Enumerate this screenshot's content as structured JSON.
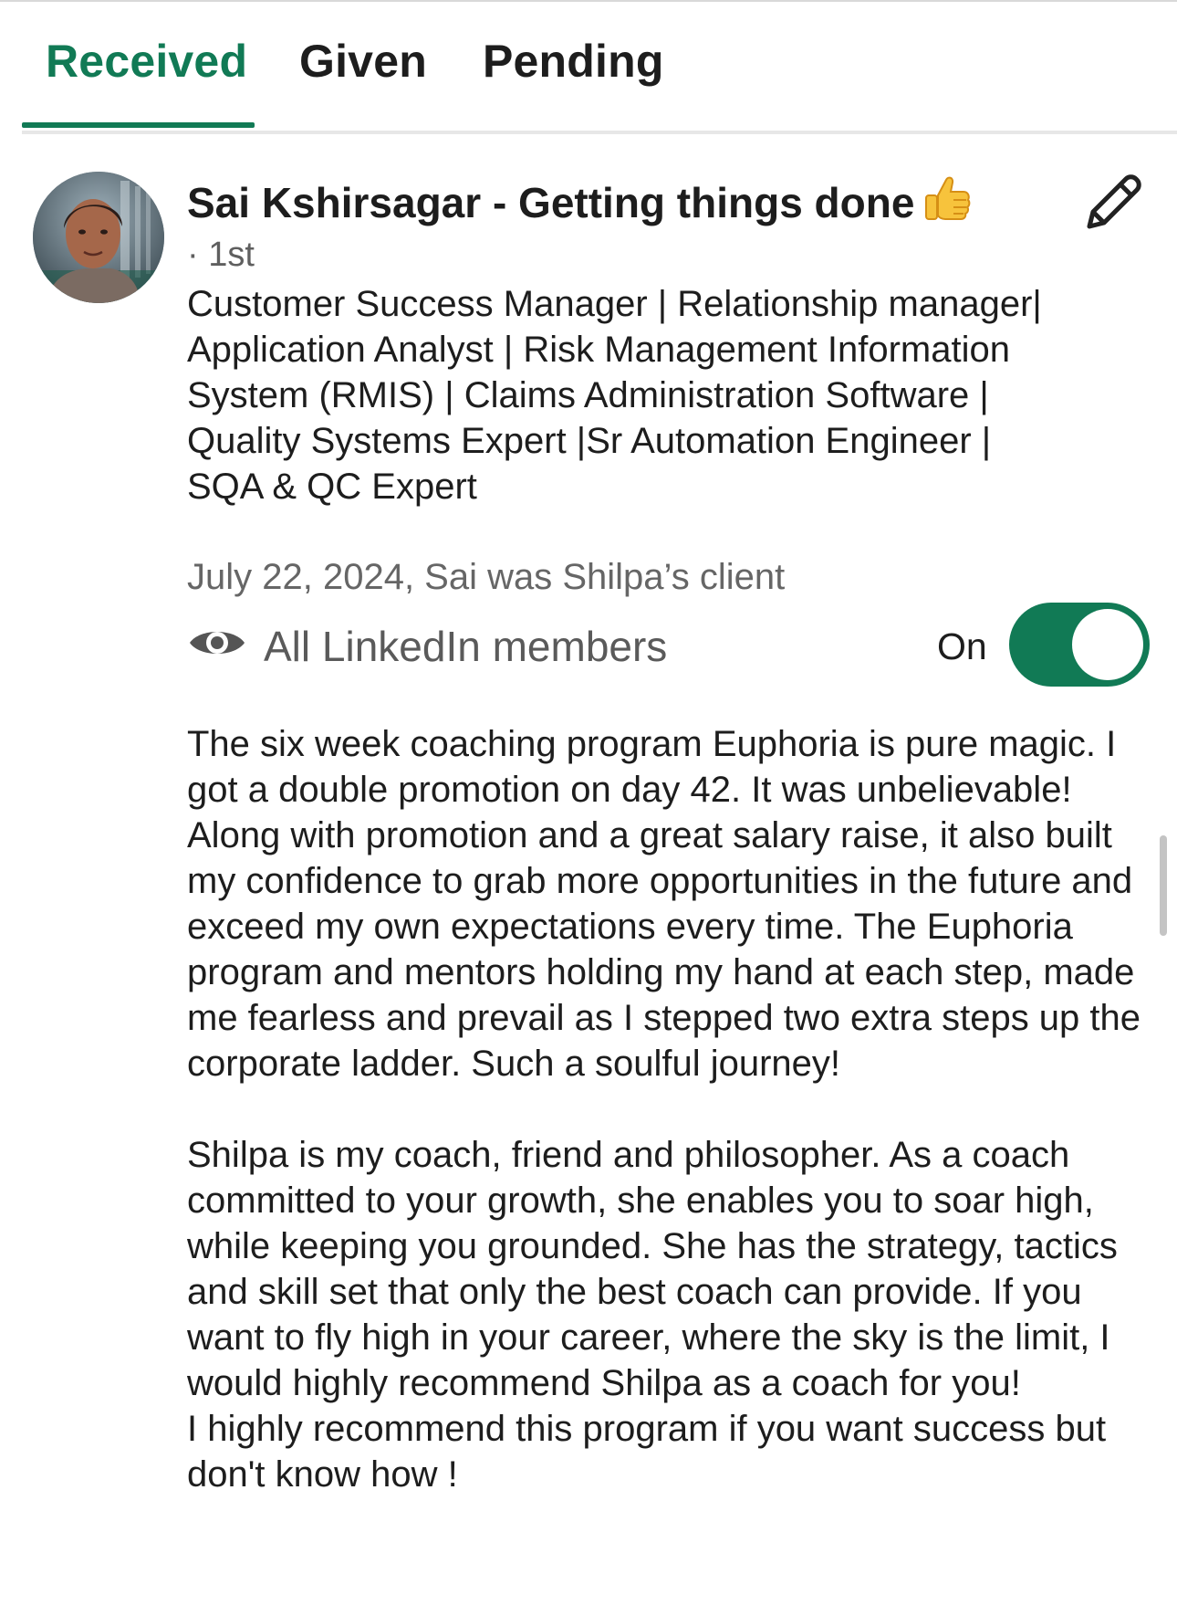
{
  "tabs": [
    {
      "label": "Received",
      "active": true
    },
    {
      "label": "Given",
      "active": false
    },
    {
      "label": "Pending",
      "active": false
    }
  ],
  "recommendation": {
    "name_title": "Sai Kshirsagar - Getting things done",
    "name_emoji": "thumbs-up",
    "degree": "· 1st",
    "headline": "Customer Success Manager | Relationship manager| Application Analyst | Risk Management Information System (RMIS) | Claims Administration Software | Quality Systems Expert |Sr Automation Engineer | SQA & QC Expert",
    "relation": "July 22, 2024, Sai was Shilpa’s client",
    "visibility": {
      "icon": "eye-icon",
      "label": "All LinkedIn members",
      "toggle_state_label": "On",
      "toggle_on": true
    },
    "body_paragraph_1": "The six week coaching program Euphoria is pure magic. I got a double promotion on day 42. It was unbelievable! Along with promotion and a great salary raise, it also built my confidence to grab more opportunities in the future and exceed my own expectations every time. The Euphoria program and mentors holding my hand at each step, made me fearless and prevail as I stepped two extra steps up the corporate ladder. Such a soulful journey!",
    "body_paragraph_2": "Shilpa is my coach, friend and philosopher. As a coach committed to your growth, she enables you to soar high, while keeping you grounded. She has the strategy, tactics and skill set that only the best coach can provide.  If you want to fly high in your career, where the sky is the limit, I would highly recommend Shilpa as a coach for you!",
    "body_paragraph_3": "I highly recommend this program if you want success but don't know how !"
  },
  "colors": {
    "accent": "#117a55",
    "text": "#1d1d1d",
    "muted": "#666666",
    "divider": "#e7e7e7"
  }
}
